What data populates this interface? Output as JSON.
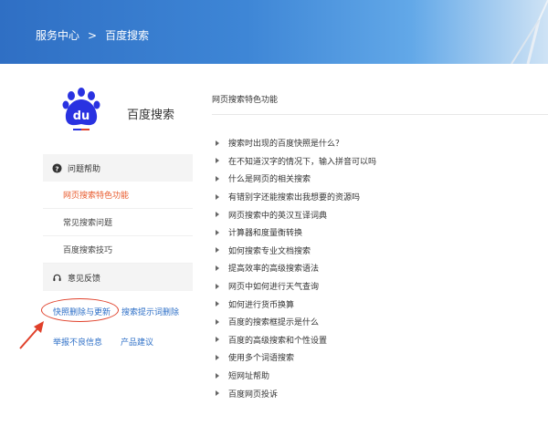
{
  "breadcrumb": {
    "home": "服务中心",
    "separator": ">",
    "current": "百度搜索"
  },
  "product": {
    "name": "百度搜索",
    "logo_text": "du"
  },
  "sidebar": {
    "help_heading": "问题帮助",
    "items": [
      {
        "label": "网页搜索特色功能"
      },
      {
        "label": "常见搜索问题"
      },
      {
        "label": "百度搜索技巧"
      }
    ],
    "feedback_heading": "意见反馈",
    "feedback_links": [
      {
        "label": "快照删除与更新"
      },
      {
        "label": "搜索提示词删除"
      }
    ],
    "other_links": [
      {
        "label": "举报不良信息"
      },
      {
        "label": "产品建议"
      }
    ]
  },
  "content": {
    "title": "网页搜索特色功能",
    "items": [
      "搜索时出现的百度快照是什么？",
      "在不知道汉字的情况下，输入拼音可以吗",
      "什么是网页的相关搜索",
      "有错别字还能搜索出我想要的资源吗",
      "网页搜索中的英汉互译词典",
      "计算器和度量衡转换",
      "如何搜索专业文档搜索",
      "提高效率的高级搜索语法",
      "网页中如何进行天气查询",
      "如何进行货币换算",
      "百度的搜索框提示是什么",
      "百度的高级搜索和个性设置",
      "使用多个词语搜索",
      "短网址帮助",
      "百度网页投诉"
    ]
  },
  "colors": {
    "accent": "#e85a2c",
    "link": "#2d6fc7",
    "brand_blue": "#2932e1",
    "annotation_red": "#e0402a"
  }
}
